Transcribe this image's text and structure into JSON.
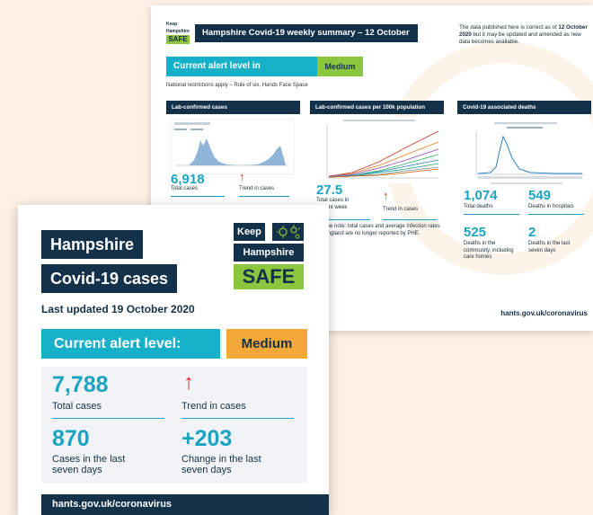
{
  "back": {
    "logo": {
      "keep": "Keep",
      "hampshire": "Hampshire",
      "safe": "SAFE"
    },
    "title": "Hampshire Covid-19 weekly summary – 12 October",
    "note_pre": "The data published here is correct as of ",
    "note_bold": "12 October 2020",
    "note_post": " but it may be updated and amended as new data becomes available.",
    "alert_label": "Current alert level in Hampshire:",
    "alert_value": "Medium",
    "restrictions": "National restrictions apply – Rule of six, Hands Face Space",
    "col1": {
      "heading": "Lab-confirmed cases",
      "total": "6,918",
      "total_label": "Total cases",
      "trend_label": "Trend in cases"
    },
    "col2": {
      "heading": "Lab-confirmed cases per 100k population",
      "value": "27.5",
      "value_label": "Total cases in current week",
      "trend_label": "Trend in cases",
      "note": "Please note: total cases and average infection rates for England are no longer reported by PHE."
    },
    "col3": {
      "heading": "Covid-19 associated deaths",
      "total_deaths": "1,074",
      "total_deaths_label": "Total deaths",
      "hosp": "549",
      "hosp_label": "Deaths in hospitals",
      "community": "525",
      "community_label": "Deaths in the community, including care homes",
      "week": "2",
      "week_label": "Deaths in the last seven days"
    },
    "url": "hants.gov.uk/coronavirus"
  },
  "front": {
    "title_line1": "Hampshire",
    "title_line2": "Covid-19 cases",
    "logo": {
      "keep": "Keep",
      "hampshire": "Hampshire",
      "safe": "SAFE"
    },
    "updated": "Last updated 19 October 2020",
    "alert_label": "Current alert level:",
    "alert_value": "Medium",
    "stats": {
      "total": "7,788",
      "total_label": "Total cases",
      "trend_label": "Trend in cases",
      "week": "870",
      "week_label": "Cases in the last seven days",
      "change": "+203",
      "change_label": "Change in the last seven days"
    },
    "url": "hants.gov.uk/coronavirus"
  },
  "colors": {
    "navy": "#14314a",
    "teal": "#16b0c8",
    "green": "#8cc63f",
    "orange": "#f4a83a",
    "red": "#e03131"
  }
}
